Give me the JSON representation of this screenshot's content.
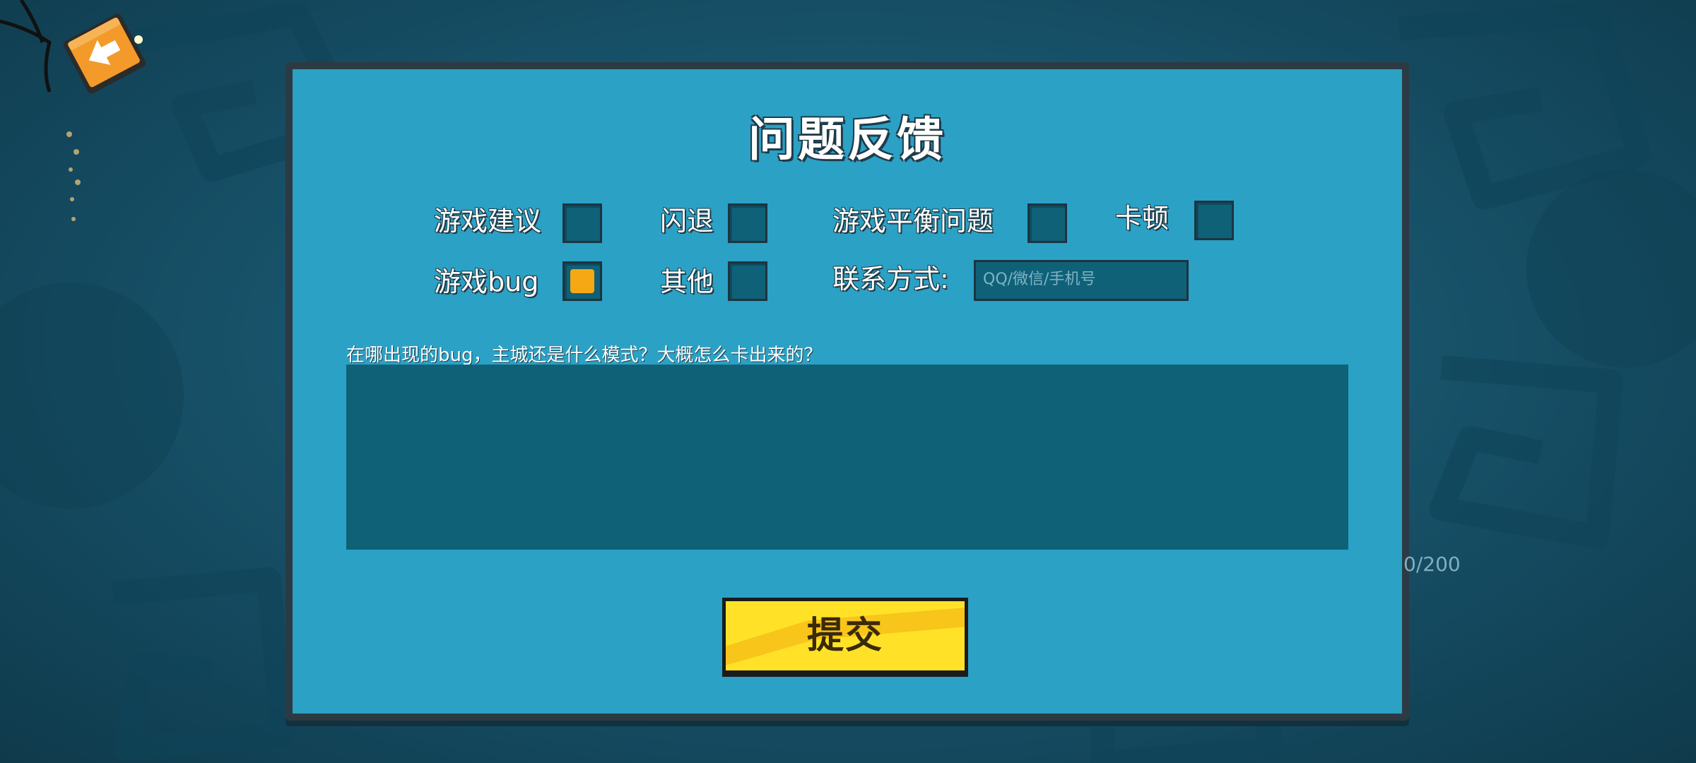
{
  "title": "问题反馈",
  "options": [
    {
      "label": "游戏建议",
      "checked": false
    },
    {
      "label": "闪退",
      "checked": false
    },
    {
      "label": "游戏平衡问题",
      "checked": false
    },
    {
      "label": "卡顿",
      "checked": false
    },
    {
      "label": "游戏bug",
      "checked": true
    },
    {
      "label": "其他",
      "checked": false
    }
  ],
  "contact": {
    "label": "联系方式:",
    "placeholder": "QQ/微信/手机号"
  },
  "feedback": {
    "prompt": "在哪出现的bug，主城还是什么模式？大概怎么卡出来的？",
    "value": "",
    "counter": "0/200"
  },
  "submit_label": "提交",
  "colors": {
    "panel": "#2ba1c5",
    "input_bg": "#0f6178",
    "checked_mark": "#f6a714",
    "button": "#ffe227",
    "back_button": "#f39a2a"
  }
}
